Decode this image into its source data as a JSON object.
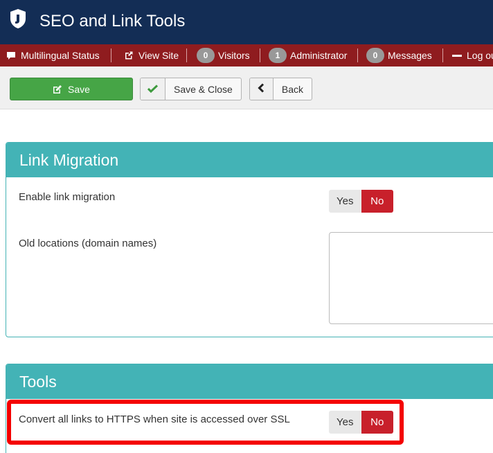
{
  "header": {
    "title": "SEO and Link Tools",
    "logo_icon": "joomla-logo-icon"
  },
  "statusbar": {
    "multilingual": "Multilingual Status",
    "view_site": "View Site",
    "visitors_count": "0",
    "visitors": "Visitors",
    "admin_count": "1",
    "administrator": "Administrator",
    "messages_count": "0",
    "messages": "Messages",
    "logout": "Log ou"
  },
  "toolbar": {
    "save": "Save",
    "save_close": "Save & Close",
    "back": "Back"
  },
  "link_migration": {
    "title": "Link Migration",
    "enable_label": "Enable link migration",
    "enable_yes": "Yes",
    "enable_no": "No",
    "enable_value": "No",
    "old_locations_label": "Old locations (domain names)",
    "old_locations_value": ""
  },
  "tools": {
    "title": "Tools",
    "https_label": "Convert all links to HTTPS when site is accessed over SSL",
    "https_yes": "Yes",
    "https_no": "No",
    "https_value": "No"
  },
  "colors": {
    "header_bg": "#132d55",
    "statusbar_bg": "#8f1c1f",
    "panel_accent": "#43b3b6",
    "save_green": "#46a546",
    "toggle_no_red": "#c8202b",
    "highlight_red": "#f40000"
  }
}
